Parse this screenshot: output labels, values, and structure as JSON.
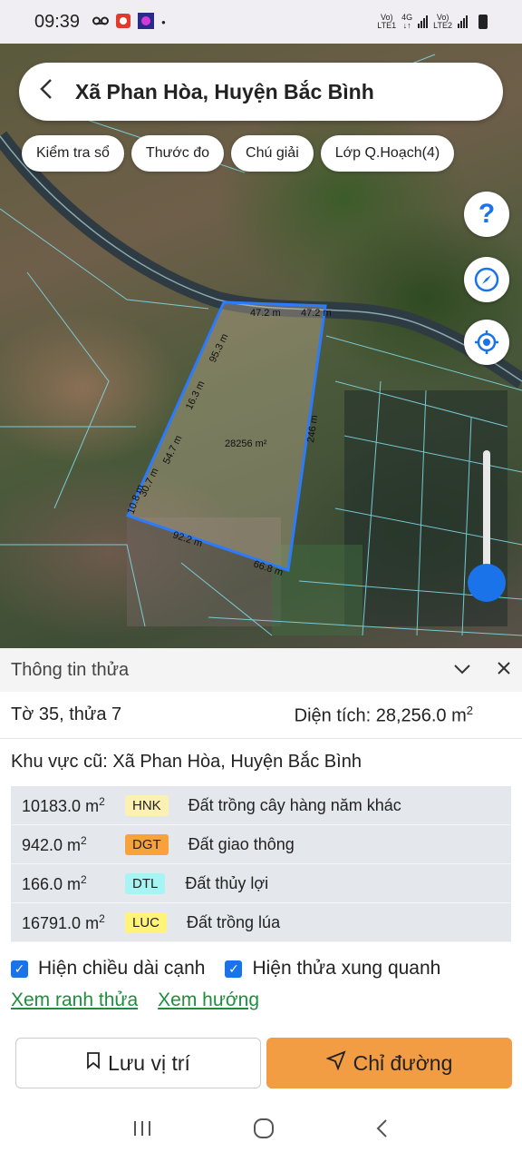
{
  "status_bar": {
    "time": "09:39",
    "net1_top": "Vo)",
    "net1_bottom": "LTE1",
    "net_type": "4G",
    "net2_top": "Vo)",
    "net2_bottom": "LTE2"
  },
  "header": {
    "title": "Xã Phan Hòa, Huyện Bắc Bình"
  },
  "chips": [
    {
      "label": "Kiểm tra sổ"
    },
    {
      "label": "Thước đo"
    },
    {
      "label": "Chú giải"
    },
    {
      "label": "Lớp Q.Hoạch(4)"
    }
  ],
  "map": {
    "parcel_area_label": "28256 m²",
    "edge_labels": [
      "47.2 m",
      "47.2 m",
      "95.3 m",
      "16.3 m",
      "54.7 m",
      "30.7 m",
      "10.8 m",
      "246 m",
      "92.2 m",
      "66.8 m"
    ],
    "boundary_color": "#2b7bff",
    "zoom_level": 0.85
  },
  "panel": {
    "title": "Thông tin thửa",
    "sheet_parcel": "Tờ 35, thửa 7",
    "area_label": "Diện tích: 28,256.0 m",
    "area_sup": "2",
    "old_area": "Khu vực cũ: Xã Phan Hòa, Huyện Bắc Bình",
    "land_uses": [
      {
        "area": "10183.0 m",
        "sup": "2",
        "code": "HNK",
        "color": "#fdf0b3",
        "name": "Đất trồng cây hàng năm khác"
      },
      {
        "area": "942.0 m",
        "sup": "2",
        "code": "DGT",
        "color": "#f7a23b",
        "name": "Đất giao thông"
      },
      {
        "area": "166.0 m",
        "sup": "2",
        "code": "DTL",
        "color": "#a8f4f4",
        "name": "Đất thủy lợi"
      },
      {
        "area": "16791.0 m",
        "sup": "2",
        "code": "LUC",
        "color": "#fff37a",
        "name": "Đất trồng lúa"
      }
    ],
    "check_edges": "Hiện chiều dài cạnh",
    "check_neighbors": "Hiện thửa xung quanh",
    "link_boundary": "Xem ranh thửa",
    "link_direction": "Xem hướng",
    "save_label": "Lưu vị trí",
    "go_label": "Chỉ đường"
  },
  "colors": {
    "accent": "#1a73e8",
    "primary_button": "#f29d44",
    "link": "#1e8e3e"
  }
}
